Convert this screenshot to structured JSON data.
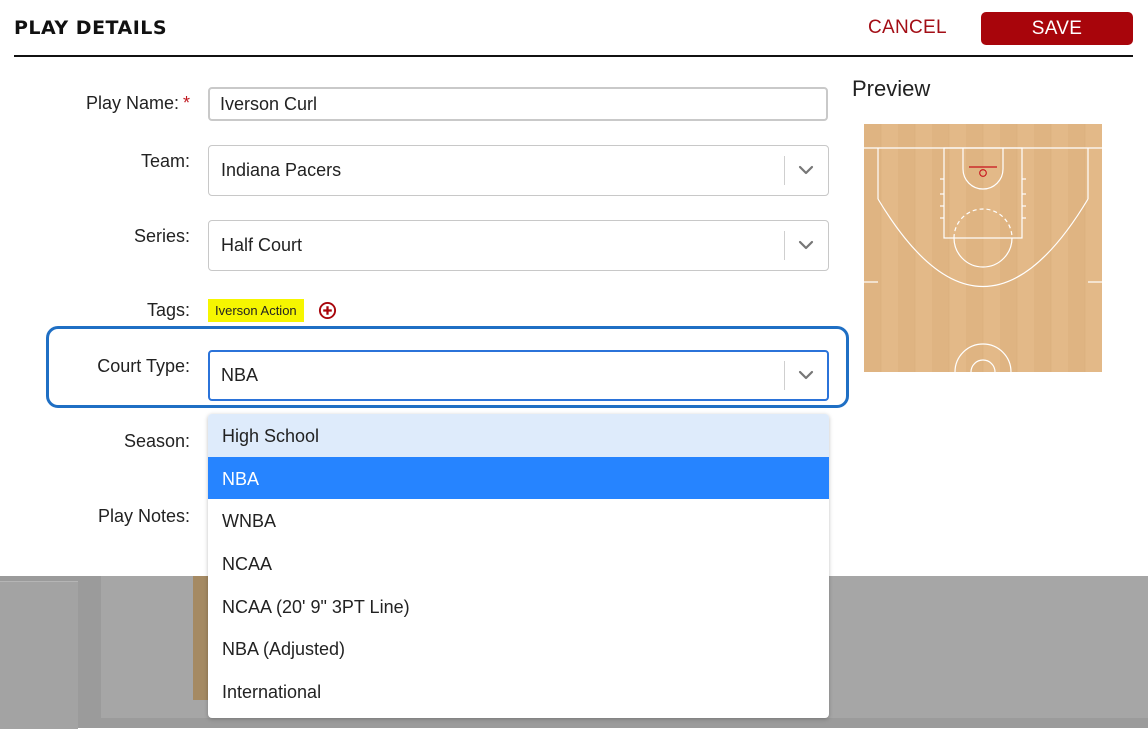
{
  "header": {
    "title": "PLAY DETAILS",
    "cancel_label": "CANCEL",
    "save_label": "SAVE"
  },
  "form": {
    "play_name": {
      "label": "Play Name:",
      "required_mark": "*",
      "value": "Iverson Curl"
    },
    "team": {
      "label": "Team:",
      "value": "Indiana Pacers"
    },
    "series": {
      "label": "Series:",
      "value": "Half Court"
    },
    "tags": {
      "label": "Tags:",
      "items": [
        "Iverson Action"
      ]
    },
    "court_type": {
      "label": "Court Type:",
      "value": "NBA",
      "options": [
        "High School",
        "NBA",
        "WNBA",
        "NCAA",
        "NCAA (20' 9\" 3PT Line)",
        "NBA (Adjusted)",
        "International"
      ],
      "hovered": "High School"
    },
    "season": {
      "label": "Season:"
    },
    "play_notes": {
      "label": "Play Notes:"
    }
  },
  "preview": {
    "title": "Preview"
  },
  "colors": {
    "brand_red": "#a8050b",
    "focus_blue": "#2b73d9",
    "selected_blue": "#2684ff",
    "tag_yellow": "#f6f600",
    "court_wood": "#e3b988"
  }
}
